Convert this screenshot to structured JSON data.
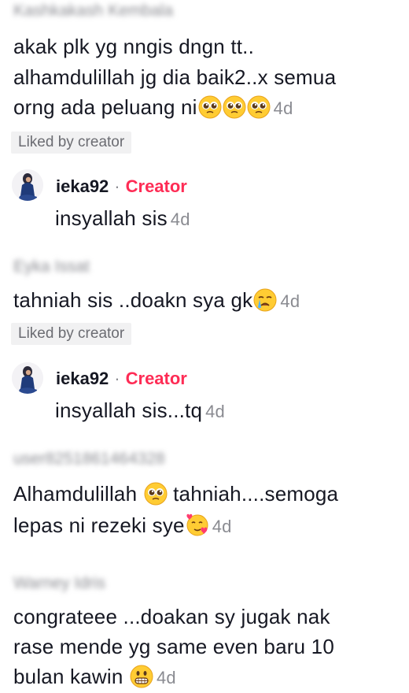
{
  "comments": [
    {
      "username": "Kashkakash Kembala",
      "lines": [
        "akak plk yg nngis dngn tt..",
        "alhamdulillah jg dia baik2..x semua",
        "orng ada peluang ni"
      ],
      "time": "4d",
      "liked_label": "Liked by creator",
      "reply": {
        "username": "ieka92",
        "separator": "·",
        "badge": "Creator",
        "text": "insyallah sis",
        "time": "4d"
      }
    },
    {
      "username": "Eyka Issat",
      "lines": [
        "tahniah sis ..doakn sya gk"
      ],
      "time": "4d",
      "liked_label": "Liked by creator",
      "reply": {
        "username": "ieka92",
        "separator": "·",
        "badge": "Creator",
        "text": "insyallah sis...tq",
        "time": "4d"
      }
    },
    {
      "username": "user8251861464328",
      "lines": [
        "Alhamdulillah",
        "tahniah....semoga",
        "lepas ni rezeki sye"
      ],
      "time": "4d"
    },
    {
      "username": "Warney Idris",
      "lines": [
        "congrateee ...doakan sy jugak nak",
        "rase mende yg same even baru 10",
        "bulan kawin"
      ],
      "time": "4d"
    }
  ],
  "colors": {
    "accent": "#fe2c55",
    "muted": "#8a8b91",
    "liked_bg": "#f1f1f2"
  },
  "icons": [
    "pleading-face-emoji",
    "crying-face-emoji",
    "smiling-hearts-emoji",
    "grinning-face-emoji",
    "avatar"
  ]
}
